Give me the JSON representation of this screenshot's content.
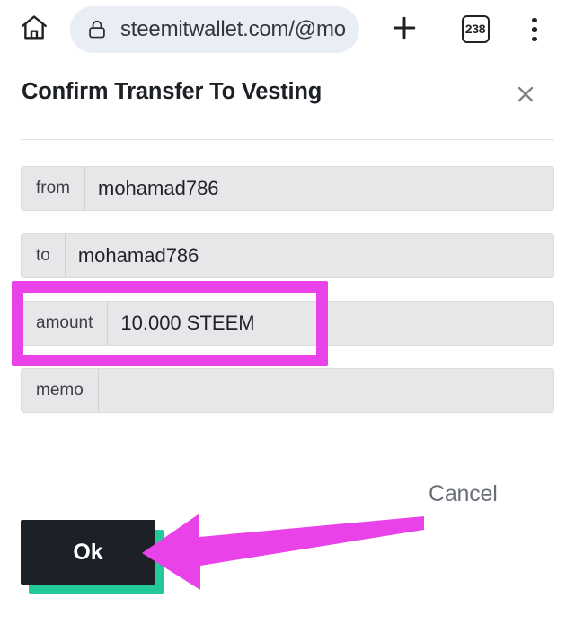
{
  "browser": {
    "home_icon": "home-icon",
    "lock_icon": "lock-icon",
    "url_text": "steemitwallet.com/@mo",
    "new_tab_icon": "plus-icon",
    "tab_count": "238",
    "menu_icon": "three-dot-menu-icon"
  },
  "dialog": {
    "title": "Confirm Transfer To Vesting",
    "close_icon": "close-icon",
    "fields": [
      {
        "label": "from",
        "value": "mohamad786"
      },
      {
        "label": "to",
        "value": "mohamad786"
      },
      {
        "label": "amount",
        "value": "10.000 STEEM"
      },
      {
        "label": "memo",
        "value": ""
      }
    ],
    "ok_label": "Ok",
    "cancel_label": "Cancel"
  },
  "annotations": {
    "highlight_color": "#e842e8",
    "arrow_color": "#e842e8",
    "highlight_target": "amount-row",
    "arrow_target": "ok-button"
  },
  "colors": {
    "accent_magenta": "#e842e8",
    "button_dark": "#1c2128",
    "button_shadow_teal": "#22c99a",
    "field_bg": "#e7e7e9",
    "url_pill_bg": "#e9edf6"
  }
}
